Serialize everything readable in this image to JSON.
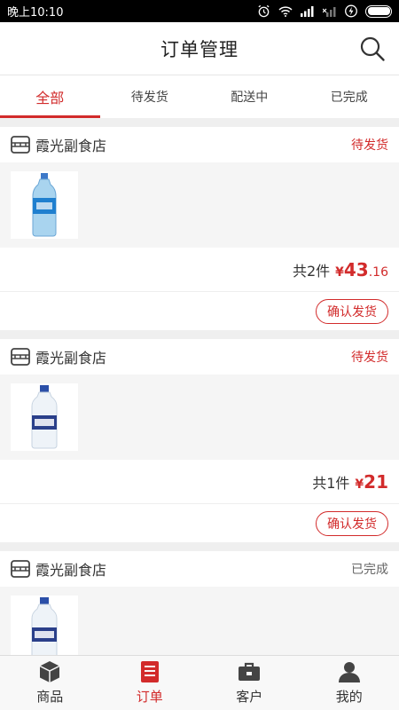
{
  "status_bar": {
    "time": "晚上10:10"
  },
  "header": {
    "title": "订单管理"
  },
  "tabs": [
    {
      "label": "全部",
      "active": true
    },
    {
      "label": "待发货",
      "active": false
    },
    {
      "label": "配送中",
      "active": false
    },
    {
      "label": "已完成",
      "active": false
    }
  ],
  "orders": [
    {
      "store": "霞光副食店",
      "status": "待发货",
      "count_text": "共2件",
      "currency": "¥",
      "price_int": "43",
      "price_dec": ".16",
      "action": "确认发货"
    },
    {
      "store": "霞光副食店",
      "status": "待发货",
      "count_text": "共1件",
      "currency": "¥",
      "price_int": "21",
      "price_dec": "",
      "action": "确认发货"
    },
    {
      "store": "霞光副食店",
      "status": "已完成"
    }
  ],
  "bottom_nav": [
    {
      "label": "商品",
      "icon": "box-icon",
      "active": false
    },
    {
      "label": "订单",
      "icon": "order-icon",
      "active": true
    },
    {
      "label": "客户",
      "icon": "briefcase-icon",
      "active": false
    },
    {
      "label": "我的",
      "icon": "person-icon",
      "active": false
    }
  ],
  "colors": {
    "accent": "#d22b2b",
    "background": "#efefef"
  }
}
